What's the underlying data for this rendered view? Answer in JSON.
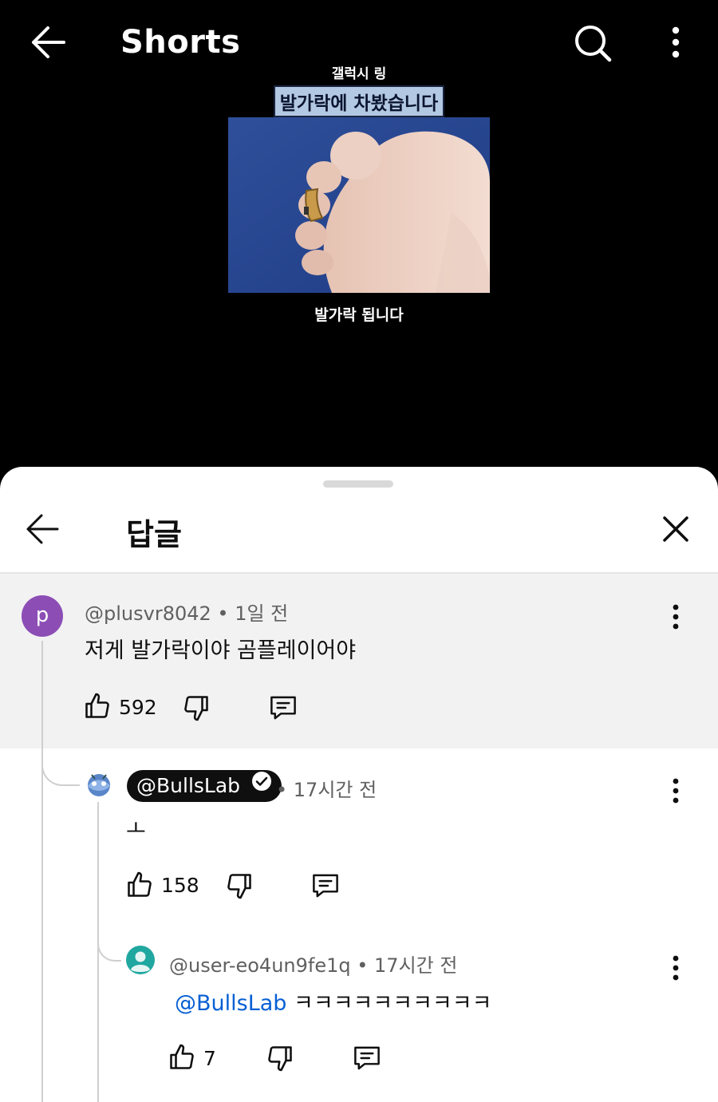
{
  "top_bar": {
    "title": "Shorts"
  },
  "video": {
    "subtitle_top": "갤럭시 링",
    "subtitle_main": "발가락에 차봤습니다",
    "caption": "발가락 됩니다"
  },
  "sheet": {
    "title": "답글"
  },
  "comments": [
    {
      "avatar_letter": "p",
      "author": "@plusvr8042",
      "time": "• 1일 전",
      "text": "저게 발가락이야 곰플레이어야",
      "likes": "592"
    },
    {
      "author": "@BullsLab",
      "time": "• 17시간 전",
      "text": "ㅗ",
      "likes": "158"
    },
    {
      "author": "@user-eo4un9fe1q",
      "time": "• 17시간 전",
      "mention": "@BullsLab",
      "text": "ㅋㅋㅋㅋㅋㅋㅋㅋㅋㅋ",
      "likes": "7"
    }
  ]
}
